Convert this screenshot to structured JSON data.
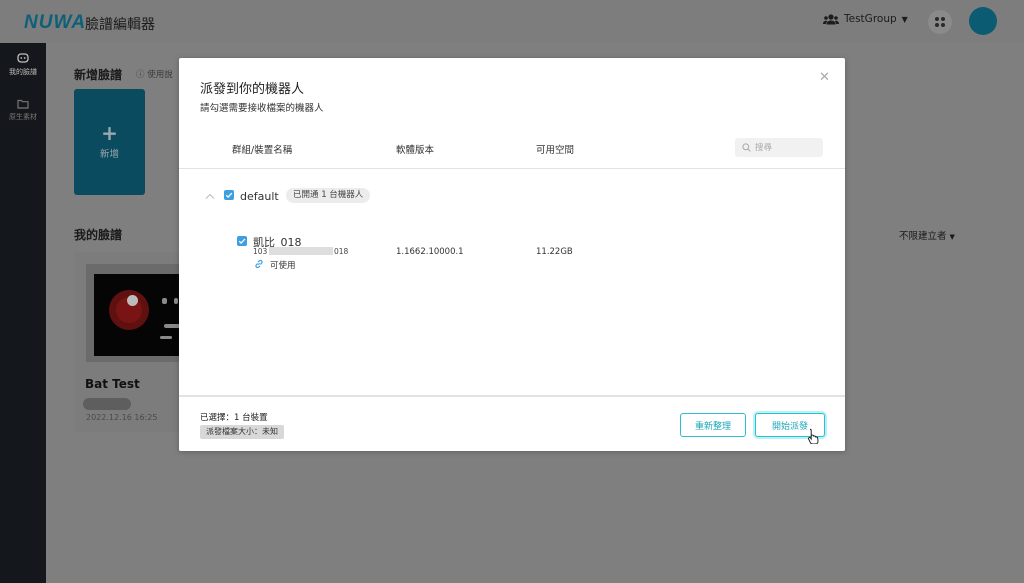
{
  "header": {
    "logo": "NUWA",
    "app_title": "臉譜編輯器",
    "group_label": "TestGroup",
    "accent_color": "#0e5f7a",
    "avatar_color": "#0b5b72"
  },
  "sidebar": {
    "items": [
      {
        "label": "我的臉譜",
        "icon": "robot-face-icon",
        "active": true
      },
      {
        "label": "原生素材",
        "icon": "folder-icon",
        "active": false
      }
    ]
  },
  "page": {
    "new_face_heading": "新增臉譜",
    "new_face_hint": "使用說",
    "new_card_label": "新增",
    "my_faces_heading": "我的臉譜",
    "filter_label": "不限建立者",
    "face_card": {
      "title": "Bat Test",
      "date": "2022.12.16 16:25"
    }
  },
  "modal": {
    "title": "派發到你的機器人",
    "subtitle": "請勾選需要接收檔案的機器人",
    "columns": [
      "群組/裝置名稱",
      "軟體版本",
      "可用空間"
    ],
    "search_placeholder": "搜尋",
    "group": {
      "name": "default",
      "badge": "已開通 1 台機器人",
      "checked": true,
      "expanded": true
    },
    "devices": [
      {
        "name": "凱比_018",
        "id_prefix": "103",
        "id_suffix": "018",
        "status": "可使用",
        "version": "1.1662.10000.1",
        "space": "11.22GB",
        "checked": true
      }
    ],
    "footer": {
      "selected_text": "已選擇：1 台裝置",
      "size_text": "派發檔案大小：未知",
      "reset_label": "重新整理",
      "start_label": "開始派發"
    },
    "accent_color": "#2cc0cf",
    "checkbox_color": "#3d9fe0"
  }
}
